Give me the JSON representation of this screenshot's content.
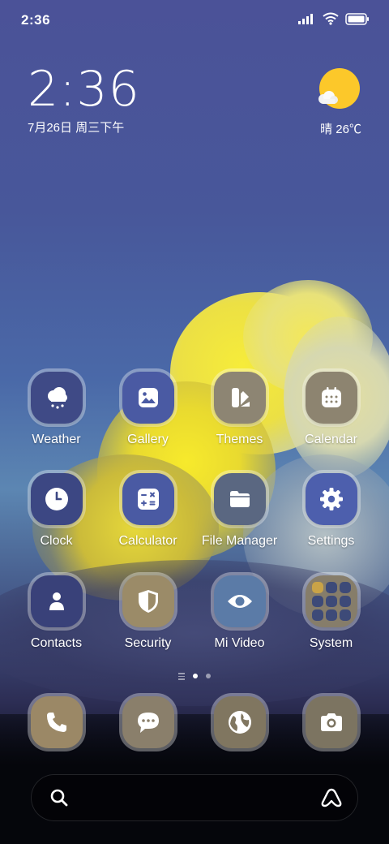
{
  "status_bar": {
    "time": "2:36"
  },
  "clock_widget": {
    "time": "2:36",
    "date": "7月26日 周三下午"
  },
  "weather_widget": {
    "condition_temp": "晴 26℃"
  },
  "apps": [
    {
      "label": "Weather",
      "icon": "weather-cloud-snow-icon",
      "bg": "#3f4a86"
    },
    {
      "label": "Gallery",
      "icon": "image-icon",
      "bg": "#4a5aa3"
    },
    {
      "label": "Themes",
      "icon": "brush-palette-icon",
      "bg": "#8d8573"
    },
    {
      "label": "Calendar",
      "icon": "calendar-icon",
      "bg": "#8d8470"
    },
    {
      "label": "Clock",
      "icon": "clock-icon",
      "bg": "#3c4783"
    },
    {
      "label": "Calculator",
      "icon": "calculator-icon",
      "bg": "#4a5aa3"
    },
    {
      "label": "File Manager",
      "icon": "folder-icon",
      "bg": "#5a6781"
    },
    {
      "label": "Settings",
      "icon": "gear-icon",
      "bg": "#4d5fad"
    },
    {
      "label": "Contacts",
      "icon": "person-icon",
      "bg": "#394179"
    },
    {
      "label": "Security",
      "icon": "shield-icon",
      "bg": "#9b8b68"
    },
    {
      "label": "Mi Video",
      "icon": "eye-icon",
      "bg": "#5b7ba7"
    },
    {
      "label": "System",
      "icon": "folder-grid-icon",
      "bg": "#867d6a"
    }
  ],
  "dock": [
    {
      "name": "phone",
      "icon": "phone-icon",
      "bg": "#9b8866"
    },
    {
      "name": "messages",
      "icon": "chat-bubble-icon",
      "bg": "#8a7f6b"
    },
    {
      "name": "browser",
      "icon": "globe-icon",
      "bg": "#807660"
    },
    {
      "name": "camera",
      "icon": "camera-icon",
      "bg": "#7c7461"
    }
  ],
  "page_indicator": {
    "pages": 2,
    "active": 0
  },
  "colors": {
    "sun": "#fcc82a",
    "cloud_yellow": "#f2e23a"
  }
}
